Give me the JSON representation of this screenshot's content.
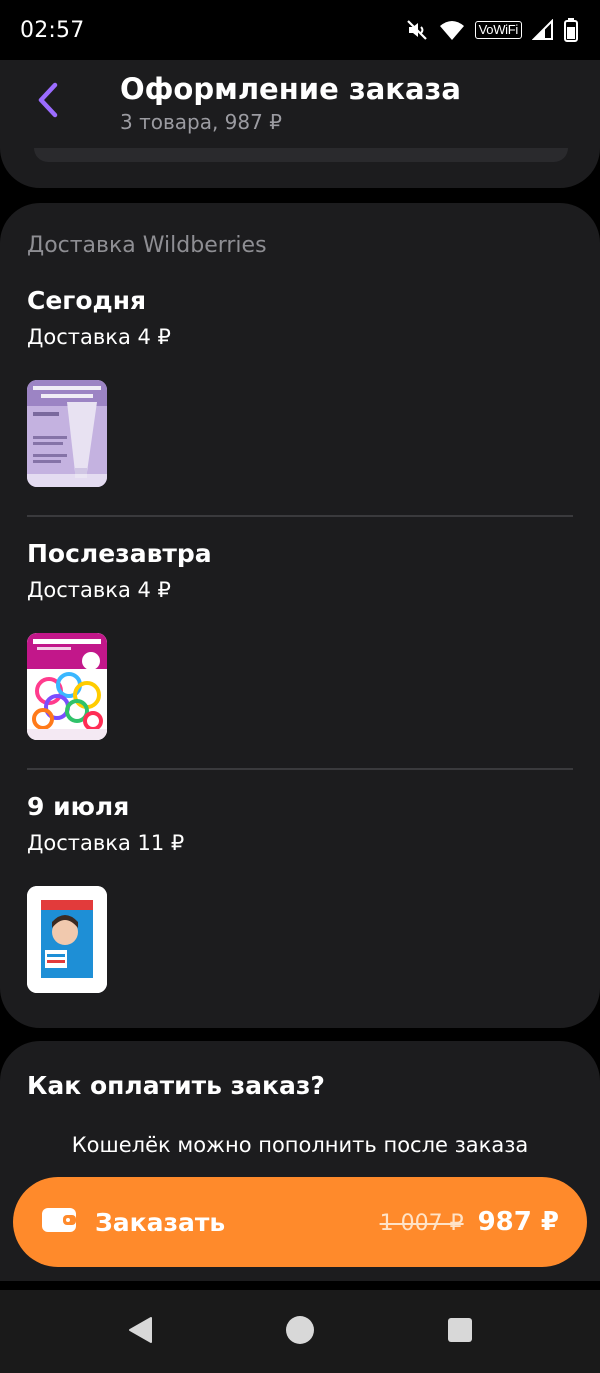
{
  "status_bar": {
    "time": "02:57",
    "vowifi": "VoWiFi",
    "icons": [
      "mute-icon",
      "wifi-icon",
      "vowifi-badge",
      "signal-icon",
      "battery-icon"
    ]
  },
  "header": {
    "title": "Оформление заказа",
    "subtitle": "3 товара, 987 ₽",
    "back_icon": "back-chevron-icon"
  },
  "delivery": {
    "heading": "Доставка Wildberries",
    "groups": [
      {
        "date": "Сегодня",
        "cost": "Доставка 4 ₽",
        "product": "sunscreen-cream"
      },
      {
        "date": "Послезавтра",
        "cost": "Доставка 4 ₽",
        "product": "hair-ties-set"
      },
      {
        "date": "9 июля",
        "cost": "Доставка 11 ₽",
        "product": "face-patches-box"
      }
    ]
  },
  "payment": {
    "title": "Как оплатить заказ?",
    "note": "Кошелёк можно пополнить после заказа"
  },
  "order_button": {
    "label": "Заказать",
    "old_price": "1 007 ₽",
    "new_price": "987 ₽",
    "icon": "wallet-icon"
  },
  "colors": {
    "accent_back": "#9b6cff",
    "order_button": "#ff8a2b",
    "card": "#1c1c1e",
    "muted_text": "#8e8e93"
  }
}
